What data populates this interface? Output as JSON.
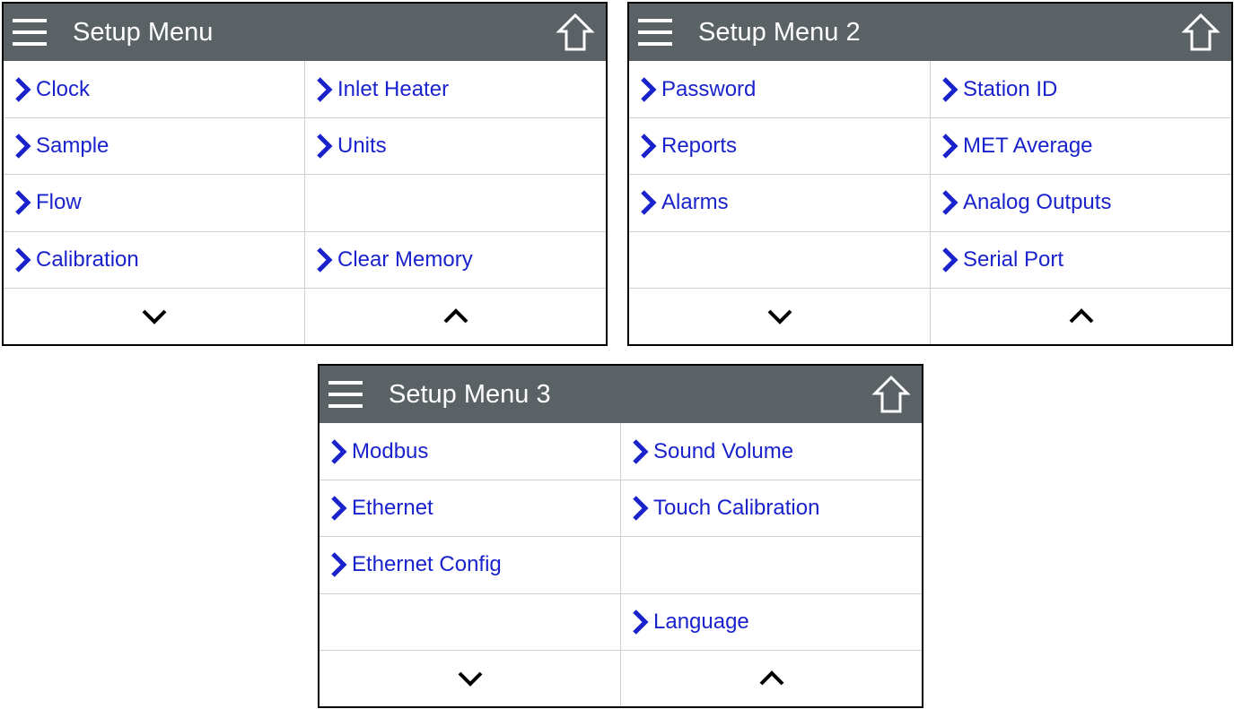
{
  "screens": [
    {
      "title": "Setup Menu",
      "items": [
        {
          "label": "Clock"
        },
        {
          "label": "Inlet Heater"
        },
        {
          "label": "Sample"
        },
        {
          "label": "Units"
        },
        {
          "label": "Flow"
        },
        {
          "label": ""
        },
        {
          "label": "Calibration"
        },
        {
          "label": "Clear Memory"
        }
      ]
    },
    {
      "title": "Setup Menu 2",
      "items": [
        {
          "label": "Password"
        },
        {
          "label": "Station ID"
        },
        {
          "label": "Reports"
        },
        {
          "label": "MET Average"
        },
        {
          "label": "Alarms"
        },
        {
          "label": "Analog Outputs"
        },
        {
          "label": ""
        },
        {
          "label": "Serial Port"
        }
      ]
    },
    {
      "title": "Setup Menu 3",
      "items": [
        {
          "label": "Modbus"
        },
        {
          "label": "Sound Volume"
        },
        {
          "label": "Ethernet"
        },
        {
          "label": "Touch Calibration"
        },
        {
          "label": "Ethernet Config"
        },
        {
          "label": ""
        },
        {
          "label": ""
        },
        {
          "label": "Language"
        }
      ]
    }
  ],
  "icons": {
    "menu": "hamburger-menu-icon",
    "home": "home-icon",
    "item": "chevron-right-icon",
    "down": "chevron-down-icon",
    "up": "chevron-up-icon"
  },
  "colors": {
    "titlebar": "#5b6266",
    "title_text": "#ffffff",
    "item_text": "#1a22cc",
    "chevron": "#1a22cc",
    "grid_line": "#cfcfcf"
  }
}
